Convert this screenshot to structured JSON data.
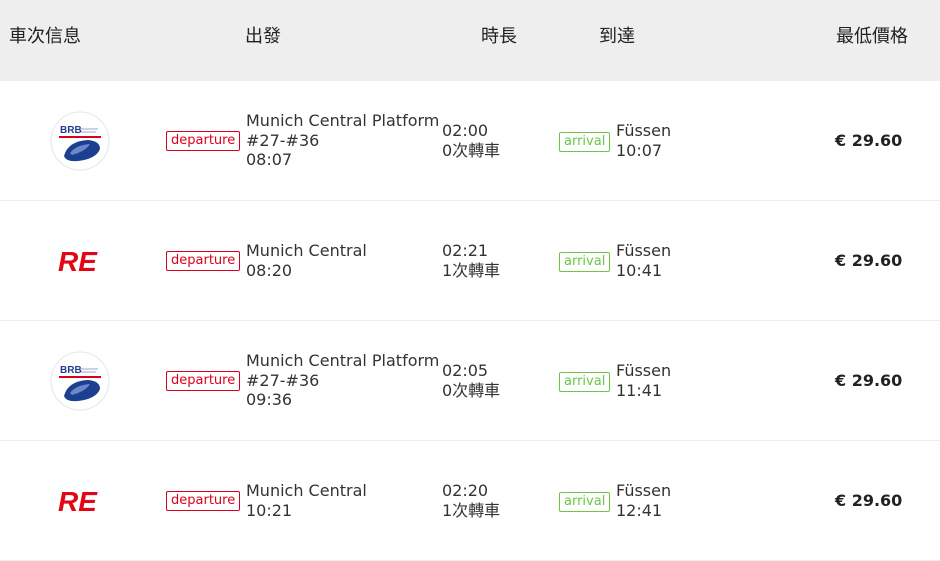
{
  "header": {
    "train_info": "車次信息",
    "departure": "出發",
    "duration": "時長",
    "arrival": "到達",
    "lowest_price": "最低價格"
  },
  "rows": [
    {
      "operator_icon": "brb-logo-icon",
      "operator_text": "BRB",
      "dep_tag": "departure",
      "dep_lines": [
        "Munich Central Platform",
        "#27-#36",
        "08:07"
      ],
      "duration": "02:00",
      "transfers": "0次轉車",
      "arr_tag": "arrival",
      "arr_station": "Füssen",
      "arr_time": "10:07",
      "price": "€ 29.60"
    },
    {
      "operator_icon": "re-logo-icon",
      "operator_text": "RE",
      "dep_tag": "departure",
      "dep_lines": [
        "Munich Central",
        "08:20"
      ],
      "duration": "02:21",
      "transfers": "1次轉車",
      "arr_tag": "arrival",
      "arr_station": "Füssen",
      "arr_time": "10:41",
      "price": "€ 29.60"
    },
    {
      "operator_icon": "brb-logo-icon",
      "operator_text": "BRB",
      "dep_tag": "departure",
      "dep_lines": [
        "Munich Central Platform",
        "#27-#36",
        "09:36"
      ],
      "duration": "02:05",
      "transfers": "0次轉車",
      "arr_tag": "arrival",
      "arr_station": "Füssen",
      "arr_time": "11:41",
      "price": "€ 29.60"
    },
    {
      "operator_icon": "re-logo-icon",
      "operator_text": "RE",
      "dep_tag": "departure",
      "dep_lines": [
        "Munich Central",
        "10:21"
      ],
      "duration": "02:20",
      "transfers": "1次轉車",
      "arr_tag": "arrival",
      "arr_station": "Füssen",
      "arr_time": "12:41",
      "price": "€ 29.60"
    }
  ],
  "colors": {
    "header_bg": "#eeeeee",
    "departure_red": "#d9001b",
    "arrival_green": "#6cc644",
    "re_red": "#e30613",
    "brb_blue": "#1d3f8f"
  }
}
